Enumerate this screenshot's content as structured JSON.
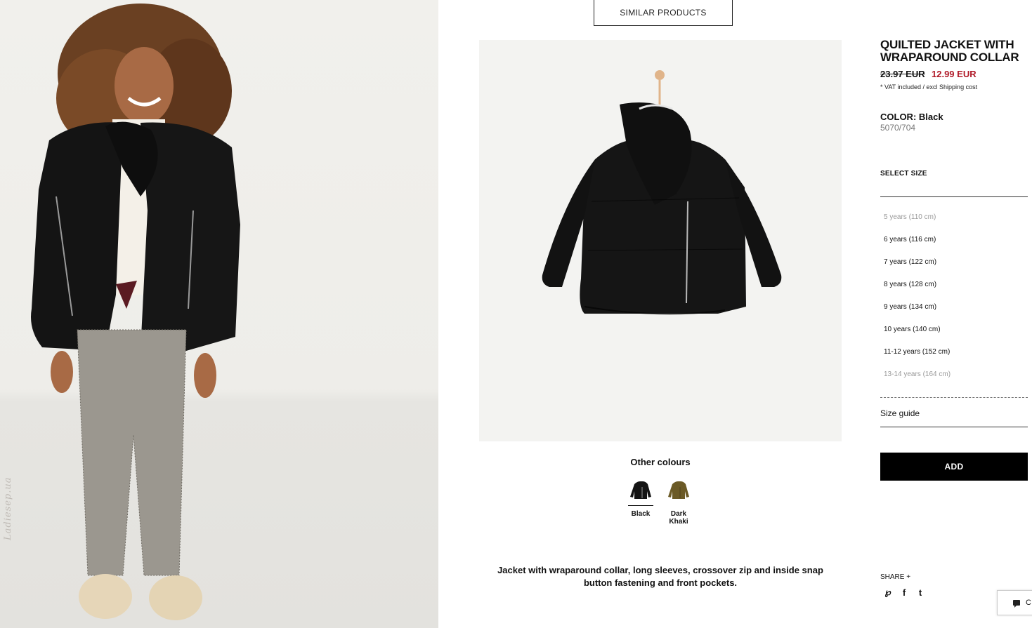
{
  "nav": {
    "similar_products": "SIMILAR PRODUCTS"
  },
  "product": {
    "title": "QUILTED JACKET WITH WRAPAROUND COLLAR",
    "old_price": "23.97 EUR",
    "new_price": "12.99 EUR",
    "vat_note": "* VAT included / excl Shipping cost",
    "color_label": "COLOR: Black",
    "reference": "5070/704",
    "description": "Jacket with wraparound collar, long sleeves, crossover zip and inside snap button fastening and front pockets."
  },
  "other_colours": {
    "title": "Other colours",
    "items": [
      {
        "label": "Black",
        "color": "#141414",
        "selected": true
      },
      {
        "label": "Dark Khaki",
        "color": "#6b5a26",
        "selected": false
      }
    ]
  },
  "sizes": {
    "title": "SELECT SIZE",
    "items": [
      {
        "label": "5 years (110 cm)",
        "available": false
      },
      {
        "label": "6 years (116 cm)",
        "available": true
      },
      {
        "label": "7 years (122 cm)",
        "available": true
      },
      {
        "label": "8 years (128 cm)",
        "available": true
      },
      {
        "label": "9 years (134 cm)",
        "available": true
      },
      {
        "label": "10 years (140 cm)",
        "available": true
      },
      {
        "label": "11-12 years (152 cm)",
        "available": true
      },
      {
        "label": "13-14 years (164 cm)",
        "available": false
      }
    ],
    "size_guide": "Size guide"
  },
  "actions": {
    "add": "ADD",
    "share": "SHARE +"
  },
  "social": [
    {
      "icon": "pinterest-icon",
      "glyph": "℘"
    },
    {
      "icon": "facebook-icon",
      "glyph": "f"
    },
    {
      "icon": "twitter-icon",
      "glyph": "t"
    }
  ],
  "chat": {
    "label": "C"
  },
  "watermark": "Ladiesep.ua",
  "colors": {
    "price_sale": "#b01927",
    "button_bg": "#000000"
  }
}
